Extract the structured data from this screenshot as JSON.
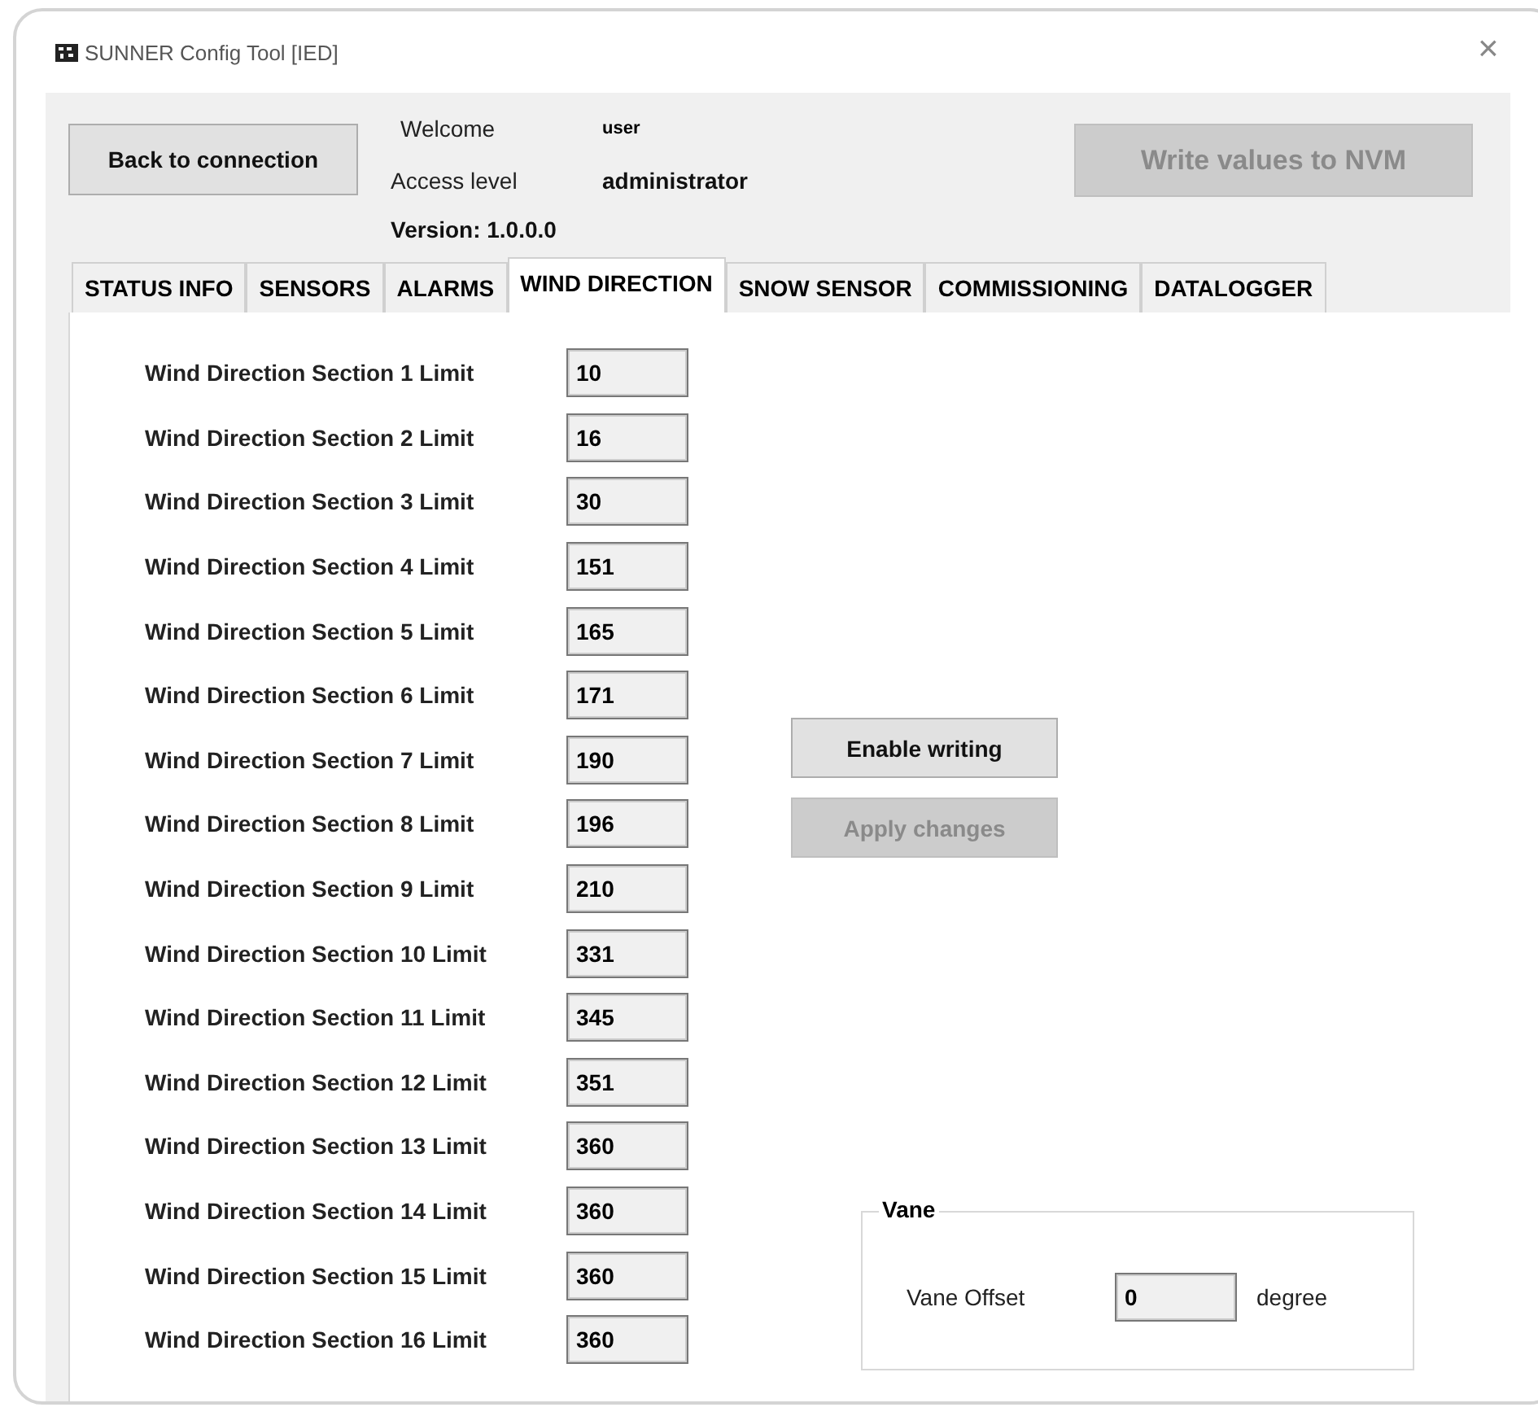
{
  "window": {
    "title": "SUNNER Config Tool [IED]",
    "close": "×"
  },
  "header": {
    "back_button": {
      "label": "Back to connection",
      "disabled": false
    },
    "welcome_label": "Welcome",
    "user": "user",
    "access_label": "Access level",
    "access_value": "administrator",
    "version": "Version: 1.0.0.0",
    "write_button": {
      "label": "Write values to NVM",
      "disabled": true
    }
  },
  "tabs": [
    {
      "label": "STATUS INFO",
      "selected": false
    },
    {
      "label": "SENSORS",
      "selected": false
    },
    {
      "label": "ALARMS",
      "selected": false
    },
    {
      "label": "WIND DIRECTION",
      "selected": true
    },
    {
      "label": "SNOW SENSOR",
      "selected": false
    },
    {
      "label": "COMMISSIONING",
      "selected": false
    },
    {
      "label": "DATALOGGER",
      "selected": false
    }
  ],
  "fields": [
    {
      "label": "Wind Direction Section 1 Limit",
      "value": "10"
    },
    {
      "label": "Wind Direction Section 2 Limit",
      "value": "16"
    },
    {
      "label": "Wind Direction Section 3 Limit",
      "value": "30"
    },
    {
      "label": "Wind Direction Section 4 Limit",
      "value": "151"
    },
    {
      "label": "Wind Direction Section 5 Limit",
      "value": "165"
    },
    {
      "label": "Wind Direction Section 6 Limit",
      "value": "171"
    },
    {
      "label": "Wind Direction Section 7 Limit",
      "value": "190"
    },
    {
      "label": "Wind Direction Section 8 Limit",
      "value": "196"
    },
    {
      "label": "Wind Direction Section 9 Limit",
      "value": "210"
    },
    {
      "label": "Wind Direction Section 10 Limit",
      "value": "331"
    },
    {
      "label": "Wind Direction Section 11 Limit",
      "value": "345"
    },
    {
      "label": "Wind Direction Section 12 Limit",
      "value": "351"
    },
    {
      "label": "Wind Direction Section 13 Limit",
      "value": "360"
    },
    {
      "label": "Wind Direction Section 14 Limit",
      "value": "360"
    },
    {
      "label": "Wind Direction Section 15 Limit",
      "value": "360"
    },
    {
      "label": "Wind Direction Section 16 Limit",
      "value": "360"
    }
  ],
  "actions": [
    {
      "label": "Enable writing",
      "disabled": false
    },
    {
      "label": "Apply changes",
      "disabled": true
    }
  ],
  "vane": {
    "title": "Vane",
    "label": "Vane Offset",
    "value": "0",
    "unit": "degree"
  }
}
